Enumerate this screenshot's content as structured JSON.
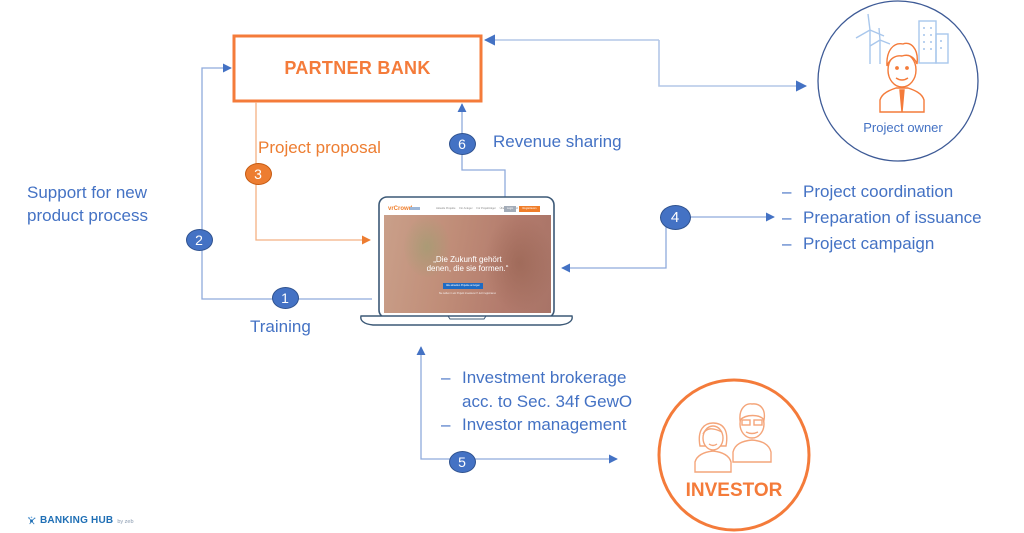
{
  "diagram": {
    "partner_bank": {
      "label": "PARTNER BANK"
    },
    "project_owner": {
      "label": "Project owner"
    },
    "investor": {
      "label": "INVESTOR"
    },
    "steps": [
      {
        "number": "1",
        "label": "Training"
      },
      {
        "number": "2",
        "label": "Support for new product process"
      },
      {
        "number": "3",
        "label": "Project proposal"
      },
      {
        "number": "4",
        "items": [
          "Project coordination",
          "Preparation of issuance",
          "Project campaign"
        ]
      },
      {
        "number": "5",
        "items": [
          "Investment brokerage acc. to Sec. 34f GewO",
          "Investor management"
        ]
      },
      {
        "number": "6",
        "label": "Revenue sharing"
      }
    ]
  },
  "laptop_screen": {
    "logo": "vrCrowd",
    "nav_links": [
      "Aktuelle Projekte",
      "Für Anleger",
      "Für Projektträger",
      "Über VR-Crowd"
    ],
    "login_label": "Login",
    "register_label": "Registrieren",
    "quote_line_1": "„Die Zukunft gehört",
    "quote_line_2": "denen, die sie formen.“",
    "cta_label": "Alle aktuellen Projekte anzeigen",
    "cta_subtext": "Sie wollen in ein Projekt investieren? Jetzt registrieren"
  },
  "footer": {
    "logo_text": "BANKING HUB",
    "logo_suffix": "by zeb"
  },
  "colors": {
    "accent_orange": "#F47B3A",
    "badge_orange": "#ED7D31",
    "accent_blue": "#4472C4",
    "line_blue": "#8FAADC",
    "badge_border": "#2F528F"
  }
}
